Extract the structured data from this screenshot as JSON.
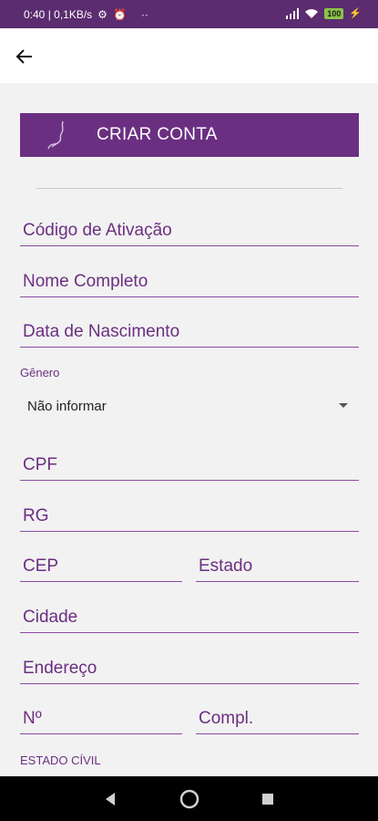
{
  "status_bar": {
    "time_info": "0:40 | 0,1KB/s",
    "battery": "100"
  },
  "app_bar": {
    "back_icon": "arrow-left-icon"
  },
  "banner": {
    "title": "CRIAR CONTA",
    "logo_icon": "brand-logo-icon"
  },
  "form": {
    "activation_code": "Código de Ativação",
    "full_name": "Nome Completo",
    "birth_date": "Data de Nascimento",
    "gender_label": "Gênero",
    "gender_value": "Não informar",
    "cpf": "CPF",
    "rg": "RG",
    "cep": "CEP",
    "state": "Estado",
    "city": "Cidade",
    "address": "Endereço",
    "number": "Nº",
    "complement": "Compl.",
    "marital_status_label": "ESTADO CÍVIL"
  },
  "colors": {
    "primary": "#6b2f82",
    "status_bar": "#5b2c6f"
  }
}
